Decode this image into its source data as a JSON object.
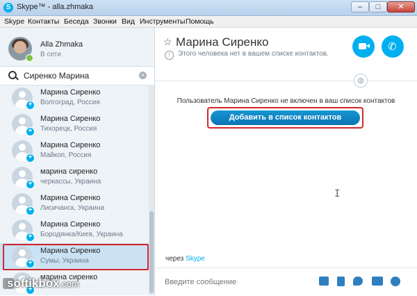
{
  "window": {
    "title": "Skype™ - alla.zhmaka",
    "app_icon": "S",
    "controls": {
      "minimize": "–",
      "maximize": "□",
      "close": "✕"
    }
  },
  "menu": [
    "Skype",
    "Контакты",
    "Беседа",
    "Звонки",
    "Вид",
    "Инструменты",
    "Помощь"
  ],
  "profile": {
    "name": "Alla Zhmaka",
    "status": "В сети",
    "status_color": "#7dc242"
  },
  "search": {
    "value": "Сиренко Марина",
    "clear_icon": "×"
  },
  "contacts": [
    {
      "name": "Марина Сиренко",
      "location": "Волгоград, Россия",
      "selected": false
    },
    {
      "name": "Марина Сиренко",
      "location": "Тихорецк, Россия",
      "selected": false
    },
    {
      "name": "Марина Сиренко",
      "location": "Майкоп, Россия",
      "selected": false
    },
    {
      "name": "марина сиренко",
      "location": "черкассы, Украина",
      "selected": false
    },
    {
      "name": "Марина Сиренко",
      "location": "Лисичанск, Украина",
      "selected": false
    },
    {
      "name": "Марина Сиренко",
      "location": "Бородянка/Киев, Украина",
      "selected": false
    },
    {
      "name": "Марина Сиренко",
      "location": "Сумы, Украина",
      "selected": true
    },
    {
      "name": "марина сиренко",
      "location": "",
      "selected": false
    }
  ],
  "conversation": {
    "star": "☆",
    "title": "Марина Сиренко",
    "not_in_contacts": "Этого человека нет в вашем списке контактов.",
    "notice": "Пользователь Марина Сиренко не включен в ваш список контактов",
    "add_button": "Добавить в список контактов",
    "via_prefix": "через",
    "via_service": "Skype",
    "message_placeholder": "Введите сообщение",
    "phone_glyph": "✆",
    "ibeam": "I",
    "globe": "◍"
  },
  "colors": {
    "accent": "#00aff0",
    "highlight_border": "#d0262b",
    "selected_row": "#cbe2f5"
  },
  "watermark": {
    "brand": "softikbox",
    "domain": ".com"
  }
}
